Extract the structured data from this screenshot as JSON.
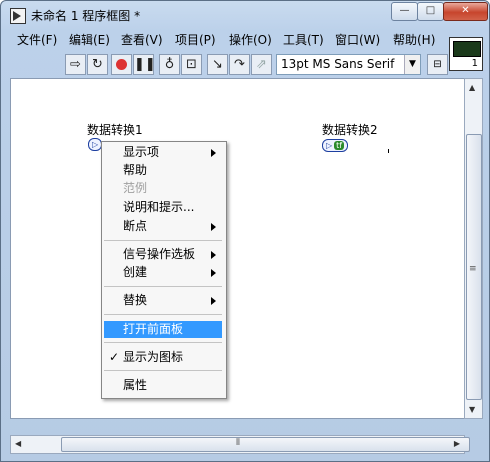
{
  "window": {
    "title": "未命名 1 程序框图 *",
    "min_label": "—",
    "max_label": "□",
    "close_label": "✕"
  },
  "menubar": {
    "items": [
      {
        "label": "文件(F)"
      },
      {
        "label": "编辑(E)"
      },
      {
        "label": "查看(V)"
      },
      {
        "label": "项目(P)"
      },
      {
        "label": "操作(O)"
      },
      {
        "label": "工具(T)"
      },
      {
        "label": "窗口(W)"
      },
      {
        "label": "帮助(H)"
      }
    ]
  },
  "toolbar": {
    "icons": [
      "run-icon",
      "run-continuously-icon",
      "abort-icon",
      "pause-icon",
      "highlight-execution-icon",
      "retain-wire-values-icon",
      "step-into-icon",
      "step-over-icon",
      "step-out-icon"
    ],
    "font_select": "13pt MS Sans Serif",
    "font_dropdown_glyph": "▼"
  },
  "connector_pane": {
    "number": "1"
  },
  "diagram": {
    "node1_label": "数据转换1",
    "node2_label": "数据转换2",
    "node1_text": "▷",
    "node2_text": "▷",
    "node2_badge": "tf"
  },
  "context_menu": {
    "items": [
      {
        "label": "显示项",
        "submenu": true
      },
      {
        "label": "帮助",
        "submenu": false
      },
      {
        "label": "范例",
        "submenu": false,
        "disabled": true
      },
      {
        "label": "说明和提示...",
        "submenu": false
      },
      {
        "label": "断点",
        "submenu": true
      },
      {
        "label": "信号操作选板",
        "submenu": true
      },
      {
        "label": "创建",
        "submenu": true
      },
      {
        "label": "替换",
        "submenu": true
      },
      {
        "label": "打开前面板",
        "submenu": false,
        "highlighted": true
      },
      {
        "label": "显示为图标",
        "submenu": false,
        "checked": true
      },
      {
        "label": "属性",
        "submenu": false
      }
    ],
    "check_glyph": "✓"
  },
  "colors": {
    "highlight": "#3399ff",
    "title_bg": "#c9dbef",
    "close_red": "#c7452d"
  }
}
